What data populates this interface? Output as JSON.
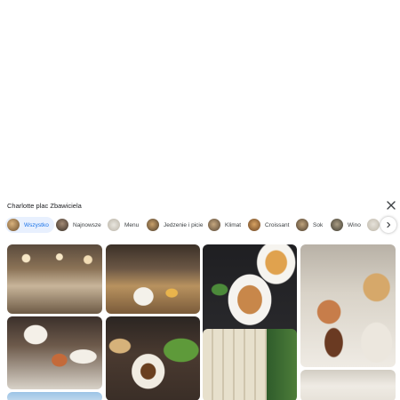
{
  "gallery": {
    "title": "Charlotte plac Zbawiciela",
    "close_icon": "close-icon",
    "scroll_icon": "chevron-right-icon",
    "accent_color": "#1a73e8",
    "chips": [
      {
        "label": "Wszystko",
        "active": true
      },
      {
        "label": "Najnowsze",
        "active": false
      },
      {
        "label": "Menu",
        "active": false
      },
      {
        "label": "Jedzenie i picie",
        "active": false
      },
      {
        "label": "Klimat",
        "active": false
      },
      {
        "label": "Croissant",
        "active": false
      },
      {
        "label": "Sok",
        "active": false
      },
      {
        "label": "Wino",
        "active": false
      },
      {
        "label": "",
        "active": false
      }
    ],
    "photos": [
      {
        "subject": "cafe-interior-counter"
      },
      {
        "subject": "breakfast-table-bar"
      },
      {
        "subject": "toast-breakfast-plate"
      },
      {
        "subject": "pastry-buffet-jars"
      },
      {
        "subject": "breakfast-table-top-view"
      },
      {
        "subject": "salad-soup-table"
      },
      {
        "subject": "building-facade"
      },
      {
        "subject": "sky-street"
      },
      {
        "subject": "interior-ceiling"
      }
    ]
  }
}
